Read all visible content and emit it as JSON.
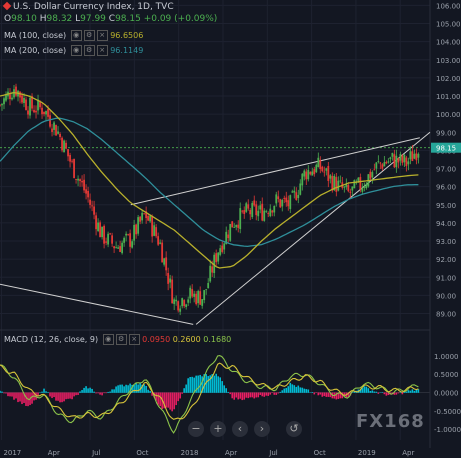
{
  "header": {
    "symbol": "U.S. Dollar Currency Index, 1D, TVC",
    "ohlc": {
      "o": "98.10",
      "h": "98.32",
      "l": "97.99",
      "c": "98.15",
      "chg": "+0.09 (+0.09%)"
    },
    "ma100": {
      "label": "MA (100, close)",
      "value": "96.6506"
    },
    "ma200": {
      "label": "MA (200, close)",
      "value": "96.1149"
    },
    "macd": {
      "label": "MACD (12, 26, close, 9)",
      "v1": "0.0950",
      "v2": "0.2600",
      "v3": "0.1680"
    }
  },
  "colors": {
    "bg": "#131722",
    "up": "#4caf50",
    "down": "#e53935",
    "ma100": "#b8b02c",
    "ma200": "#2f8f9a",
    "macd": "#8bc34a",
    "signal": "#d6c33a",
    "hist_pos": "#00bcd4",
    "hist_neg": "#e91e63",
    "trend": "#d0d0d0"
  },
  "last_price_label": "98.15",
  "watermark": "FX168",
  "zoom_buttons": [
    "−",
    "+",
    "‹",
    "›",
    "↺"
  ],
  "chart_data": {
    "type": "line",
    "title": "U.S. Dollar Currency Index, 1D, TVC",
    "x_labels": [
      "2017",
      "Apr",
      "Jul",
      "Oct",
      "2018",
      "Apr",
      "Jul",
      "Oct",
      "2019",
      "Apr"
    ],
    "y_ticks": [
      89.0,
      90.0,
      91.0,
      92.0,
      93.0,
      94.0,
      95.0,
      96.0,
      97.0,
      98.0,
      99.0,
      100.0,
      101.0,
      102.0,
      103.0,
      104.0,
      105.0,
      106.0
    ],
    "ylim": [
      88.2,
      106.3
    ],
    "x_months": [
      0,
      1,
      2,
      3,
      4,
      5,
      6,
      7,
      8,
      9,
      10,
      11,
      12,
      13,
      14,
      15,
      16,
      17,
      18,
      19,
      20,
      21,
      22,
      23,
      24,
      25,
      26,
      27,
      28,
      28.8
    ],
    "close_monthly": [
      100.5,
      101.5,
      100.4,
      100.3,
      99.0,
      97.1,
      95.5,
      93.3,
      92.7,
      93.1,
      94.5,
      92.9,
      89.6,
      90.0,
      89.9,
      92.5,
      94.0,
      94.6,
      94.6,
      95.2,
      95.0,
      96.8,
      97.1,
      96.2,
      95.6,
      96.2,
      97.2,
      97.5,
      97.3,
      98.15
    ],
    "ma100_monthly": [
      101.0,
      101.2,
      101.0,
      100.6,
      99.8,
      98.9,
      97.8,
      96.8,
      95.9,
      95.1,
      94.6,
      94.1,
      93.6,
      92.9,
      92.2,
      91.5,
      91.6,
      92.2,
      93.0,
      93.7,
      94.3,
      94.9,
      95.5,
      95.9,
      96.2,
      96.3,
      96.4,
      96.5,
      96.6,
      96.65
    ],
    "ma200_monthly": [
      97.4,
      98.3,
      99.1,
      99.6,
      99.8,
      99.6,
      99.2,
      98.6,
      97.9,
      97.2,
      96.5,
      95.7,
      95.0,
      94.3,
      93.6,
      93.1,
      92.8,
      92.7,
      92.8,
      93.1,
      93.5,
      93.9,
      94.4,
      94.9,
      95.3,
      95.6,
      95.8,
      96.0,
      96.1,
      96.11
    ],
    "trendlines": [
      {
        "from": [
          13.5,
          88.4
        ],
        "to": [
          29.6,
          99.0
        ]
      },
      {
        "from": [
          9.0,
          95.0
        ],
        "to": [
          28.9,
          98.7
        ]
      },
      {
        "from": [
          -0.5,
          90.7
        ],
        "to": [
          13.3,
          88.4
        ]
      }
    ],
    "macd": {
      "ylim": [
        -1.3,
        1.3
      ],
      "y_ticks": [
        1.0,
        0.5,
        0.0,
        -0.5,
        -1.0
      ],
      "macd_monthly": [
        0.75,
        0.4,
        -0.2,
        -0.05,
        -0.6,
        -0.8,
        -0.5,
        -0.7,
        -0.3,
        0.1,
        0.4,
        -0.4,
        -1.1,
        -0.3,
        0.4,
        1.05,
        0.6,
        0.3,
        0.15,
        0.1,
        0.45,
        0.5,
        0.25,
        -0.05,
        -0.1,
        0.25,
        0.15,
        0.0,
        0.1,
        0.2
      ],
      "signal_monthly": [
        0.7,
        0.5,
        0.05,
        -0.1,
        -0.45,
        -0.7,
        -0.6,
        -0.65,
        -0.4,
        -0.05,
        0.25,
        -0.15,
        -0.8,
        -0.55,
        0.1,
        0.75,
        0.7,
        0.4,
        0.2,
        0.12,
        0.3,
        0.45,
        0.3,
        0.05,
        -0.05,
        0.15,
        0.15,
        0.05,
        0.08,
        0.15
      ]
    }
  }
}
